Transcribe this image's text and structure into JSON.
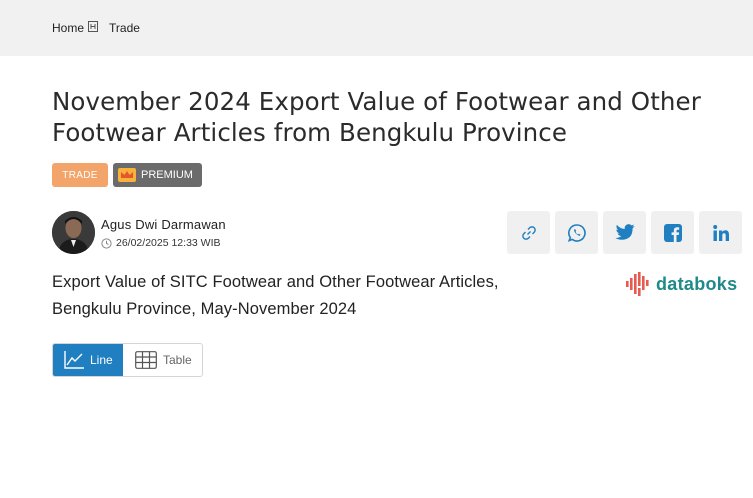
{
  "breadcrumb": {
    "home": "Home",
    "current": "Trade"
  },
  "article": {
    "title": "November 2024 Export Value of Footwear and Other Footwear Articles from Bengkulu Province",
    "badges": {
      "category": "TRADE",
      "premium": "PREMIUM"
    },
    "author": "Agus Dwi Darmawan",
    "date": "26/02/2025 12:33 WIB"
  },
  "share": {
    "icons": [
      "link-icon",
      "whatsapp-icon",
      "twitter-icon",
      "facebook-icon",
      "linkedin-icon"
    ]
  },
  "chart_header": {
    "title": "Export Value of SITC Footwear and Other Footwear Articles, Bengkulu Province, May-November 2024",
    "brand": "databoks"
  },
  "view_toggle": {
    "line": "Line",
    "table": "Table",
    "selected": "Line"
  },
  "colors": {
    "accent": "#1f7fc1",
    "trade_badge": "#f2a46a",
    "premium_badge": "#6b6b6b",
    "brand": "#1f8a8a"
  }
}
